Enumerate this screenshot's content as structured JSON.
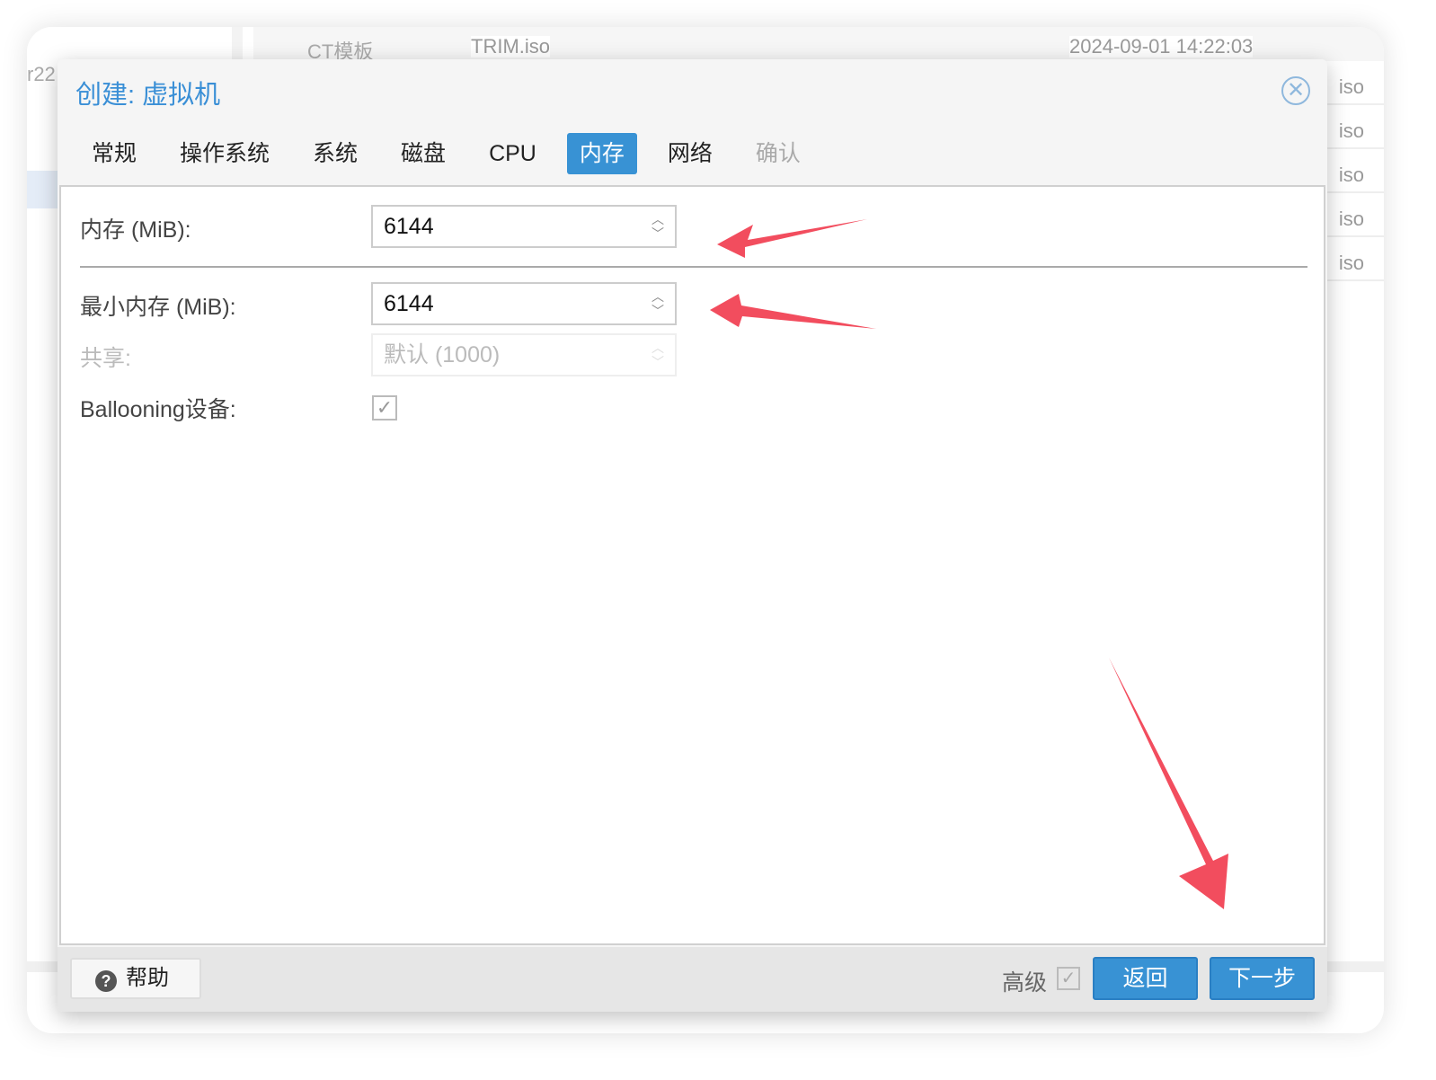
{
  "background": {
    "left_text": "r22",
    "header_tab": "CT模板",
    "row_name": "TRIM.iso",
    "row_date": "2024-09-01 14:22:03",
    "row_types": [
      "iso",
      "iso",
      "iso",
      "iso",
      "iso"
    ]
  },
  "dialog": {
    "title": "创建: 虚拟机",
    "tabs": [
      {
        "label": "常规"
      },
      {
        "label": "操作系统"
      },
      {
        "label": "系统"
      },
      {
        "label": "磁盘"
      },
      {
        "label": "CPU"
      },
      {
        "label": "内存",
        "active": true
      },
      {
        "label": "网络"
      },
      {
        "label": "确认",
        "disabled": true
      }
    ],
    "form": {
      "memory_label": "内存 (MiB):",
      "memory_value": "6144",
      "min_memory_label": "最小内存 (MiB):",
      "min_memory_value": "6144",
      "shares_label": "共享:",
      "shares_placeholder": "默认 (1000)",
      "ballooning_label": "Ballooning设备:",
      "ballooning_checked": true
    },
    "footer": {
      "help": "帮助",
      "advanced": "高级",
      "advanced_checked": true,
      "back": "返回",
      "next": "下一步"
    }
  },
  "annotation_color": "#f24d5e"
}
